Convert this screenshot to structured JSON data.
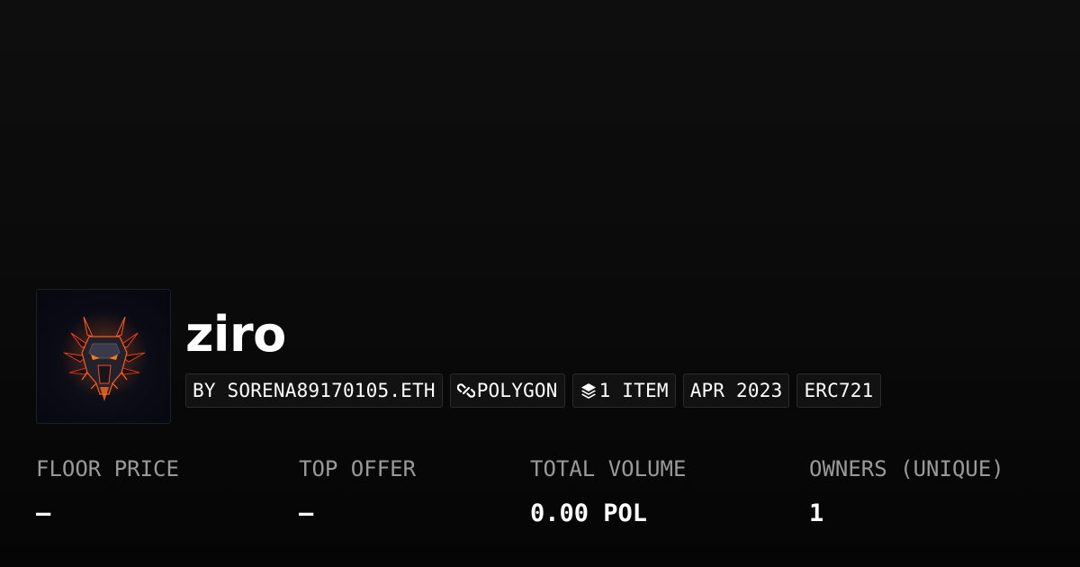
{
  "collection": {
    "name": "ziro",
    "avatar_icon": "dragon-head-icon"
  },
  "badges": {
    "creator": "BY SORENA89170105.ETH",
    "chain": "POLYGON",
    "chain_icon": "polygon-link-icon",
    "items": "1 ITEM",
    "items_icon": "layers-icon",
    "created": "APR 2023",
    "standard": "ERC721"
  },
  "stats": {
    "floor_price": {
      "label": "FLOOR PRICE",
      "value": "–"
    },
    "top_offer": {
      "label": "TOP OFFER",
      "value": "–"
    },
    "total_volume": {
      "label": "TOTAL VOLUME",
      "value": "0.00 POL"
    },
    "owners": {
      "label": "OWNERS (UNIQUE)",
      "value": "1"
    }
  },
  "colors": {
    "background": "#0b0b0b",
    "label": "#9a9a9a",
    "badge_border": "#2a2a2a",
    "accent_fire": "#ff5a1a"
  }
}
